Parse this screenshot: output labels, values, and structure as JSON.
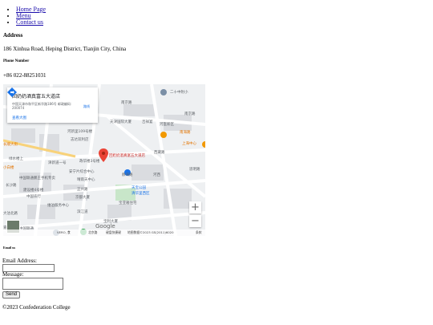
{
  "nav": {
    "items": [
      "Home Page",
      "Menu",
      "Contact us"
    ]
  },
  "address": {
    "heading": "Address",
    "text": "186 Xinhua Road, Heping District, Tianjin City, China"
  },
  "phone": {
    "heading": "Phone Number",
    "text": "+86 022-88251031"
  },
  "map": {
    "place_title": "回奶奶酒真富五大道店",
    "place_address": "中国天津市和平区新华路186号 邮政编码: 200074",
    "view_larger": "查看大图",
    "directions_label": "路线",
    "marker_label": "回奶奶酒真富五大道店",
    "labels": [
      "南京路",
      "二十中附小",
      "南京路",
      "天津国际大厦",
      "吉祥宴",
      "河医新区",
      "河新里109号楼",
      "志达双利店",
      "长顺大街",
      "南海路",
      "上海中心",
      "小白楼",
      "绿水楼上",
      "津新道一号",
      "政华楼3号楼",
      "电建蓉南",
      "安宁片综合中心",
      "中国联通鹏王手机专卖",
      "晴雨天中心",
      "建设楼4号楼",
      "中国农行",
      "京都大厦",
      "长沙路",
      "思明路",
      "正兴路",
      "维泊服务中心",
      "天宝公园",
      "清华里西区",
      "滨江道",
      "大沽北路",
      "宝亚雅住宅",
      "西藏路",
      "静海路",
      "宝利大厦",
      "河西",
      "嘉德大厦",
      "中国联通",
      "北京路"
    ],
    "zoom_in": "+",
    "zoom_out": "−",
    "google_logo": "Google",
    "footer_items": [
      "键盘快捷键",
      "地图数据©2023 GS(2011)6020",
      "条款"
    ],
    "bottom_labels": [
      "VERO, 食",
      "北京路"
    ],
    "colors": {
      "marker": "#ea4335",
      "water": "#aadaff",
      "park": "#c8e6c9",
      "road": "#ffffff",
      "building": "#dadce0"
    }
  },
  "email": {
    "heading": "Email us",
    "email_label": "Email Address:",
    "message_label": "Message:",
    "send_label": "Send"
  },
  "footer": {
    "copyright": "©2023 Confederation College"
  }
}
